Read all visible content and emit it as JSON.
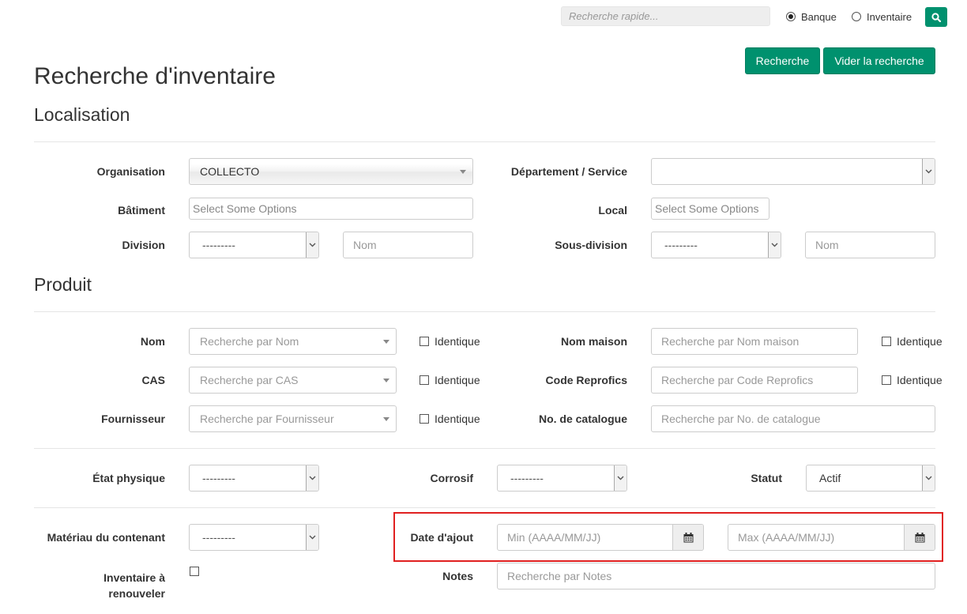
{
  "topbar": {
    "quick_search_placeholder": "Recherche rapide...",
    "radio_banque": "Banque",
    "radio_inventaire": "Inventaire",
    "selected": "Banque"
  },
  "actions": {
    "search": "Recherche",
    "clear": "Vider la recherche"
  },
  "page_title": "Recherche d'inventaire",
  "localisation": {
    "heading": "Localisation",
    "organisation_label": "Organisation",
    "organisation_value": "COLLECTO",
    "departement_label": "Département / Service",
    "departement_value": "",
    "batiment_label": "Bâtiment",
    "batiment_placeholder": "Select Some Options",
    "local_label": "Local",
    "local_placeholder": "Select Some Options",
    "division_label": "Division",
    "division_value": "---------",
    "division_nom_placeholder": "Nom",
    "sousdivision_label": "Sous-division",
    "sousdivision_value": "---------",
    "sousdivision_nom_placeholder": "Nom"
  },
  "produit": {
    "heading": "Produit",
    "nom_label": "Nom",
    "nom_placeholder": "Recherche par Nom",
    "identique": "Identique",
    "nom_maison_label": "Nom maison",
    "nom_maison_placeholder": "Recherche par Nom maison",
    "cas_label": "CAS",
    "cas_placeholder": "Recherche par CAS",
    "reprofics_label": "Code Reprofics",
    "reprofics_placeholder": "Recherche par Code Reprofics",
    "fournisseur_label": "Fournisseur",
    "fournisseur_placeholder": "Recherche par Fournisseur",
    "catalogue_label": "No. de catalogue",
    "catalogue_placeholder": "Recherche par No. de catalogue"
  },
  "details": {
    "etat_label": "État physique",
    "etat_value": "---------",
    "corrosif_label": "Corrosif",
    "corrosif_value": "---------",
    "statut_label": "Statut",
    "statut_value": "Actif",
    "materiau_label": "Matériau du contenant",
    "materiau_value": "---------",
    "date_label": "Date d'ajout",
    "date_min_placeholder": "Min (AAAA/MM/JJ)",
    "date_max_placeholder": "Max (AAAA/MM/JJ)",
    "renouveler_label_1": "Inventaire à",
    "renouveler_label_2": "renouveler",
    "notes_label": "Notes",
    "notes_placeholder": "Recherche par Notes"
  },
  "colors": {
    "accent": "#00916e",
    "highlight": "#e02020"
  }
}
